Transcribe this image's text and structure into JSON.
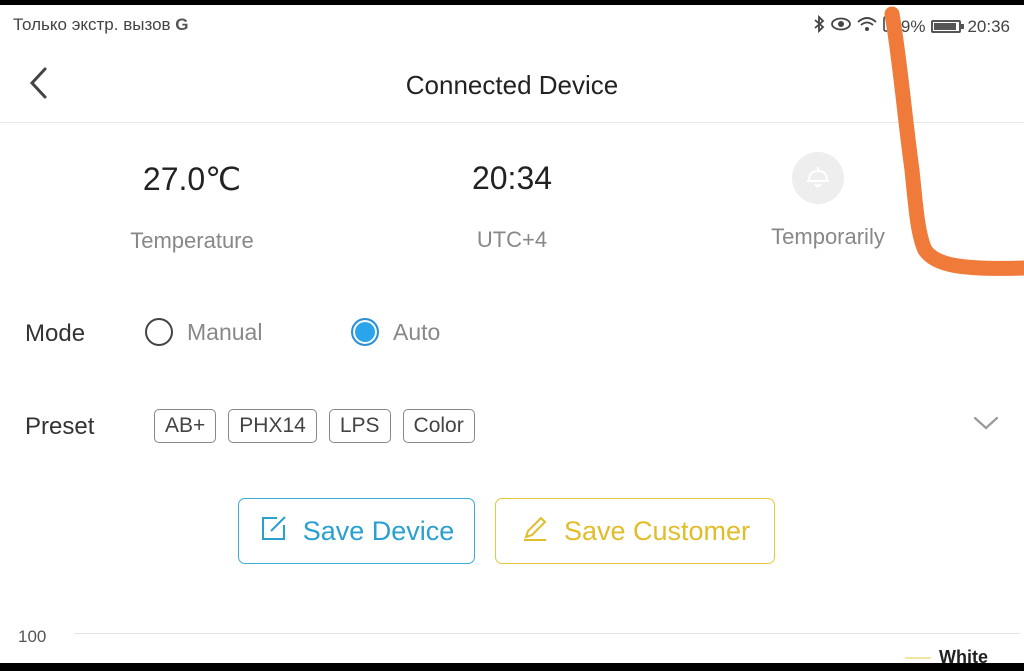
{
  "status_bar": {
    "carrier": "Только экстр. вызов",
    "g_label": "G",
    "battery_text": "9%",
    "battery_fraction": 0.9,
    "time": "20:36",
    "icons": [
      "bluetooth-icon",
      "eye-icon",
      "wifi-icon",
      "sim-alert-icon",
      "battery-icon"
    ]
  },
  "header": {
    "title": "Connected Device",
    "back_icon": "chevron-left-icon"
  },
  "info": {
    "temperature_value": "27.0℃",
    "temperature_label": "Temperature",
    "time_value": "20:34",
    "time_label": "UTC+4",
    "lamp_icon": "lamp-icon",
    "lamp_label": "Temporarily"
  },
  "mode": {
    "label": "Mode",
    "options": [
      {
        "label": "Manual",
        "selected": false
      },
      {
        "label": "Auto",
        "selected": true
      }
    ]
  },
  "preset": {
    "label": "Preset",
    "tags": [
      "AB+",
      "PHX14",
      "LPS",
      "Color"
    ],
    "expand_icon": "chevron-down-icon"
  },
  "actions": {
    "save_device": "Save Device",
    "save_device_color": "#2aa0d0",
    "save_customer": "Save Customer",
    "save_customer_color": "#e2bd2a"
  },
  "chart": {
    "y_tick": "100",
    "legend_label": "White",
    "legend_color": "#f3e6a0"
  },
  "annotation_color": "#f07a3a"
}
